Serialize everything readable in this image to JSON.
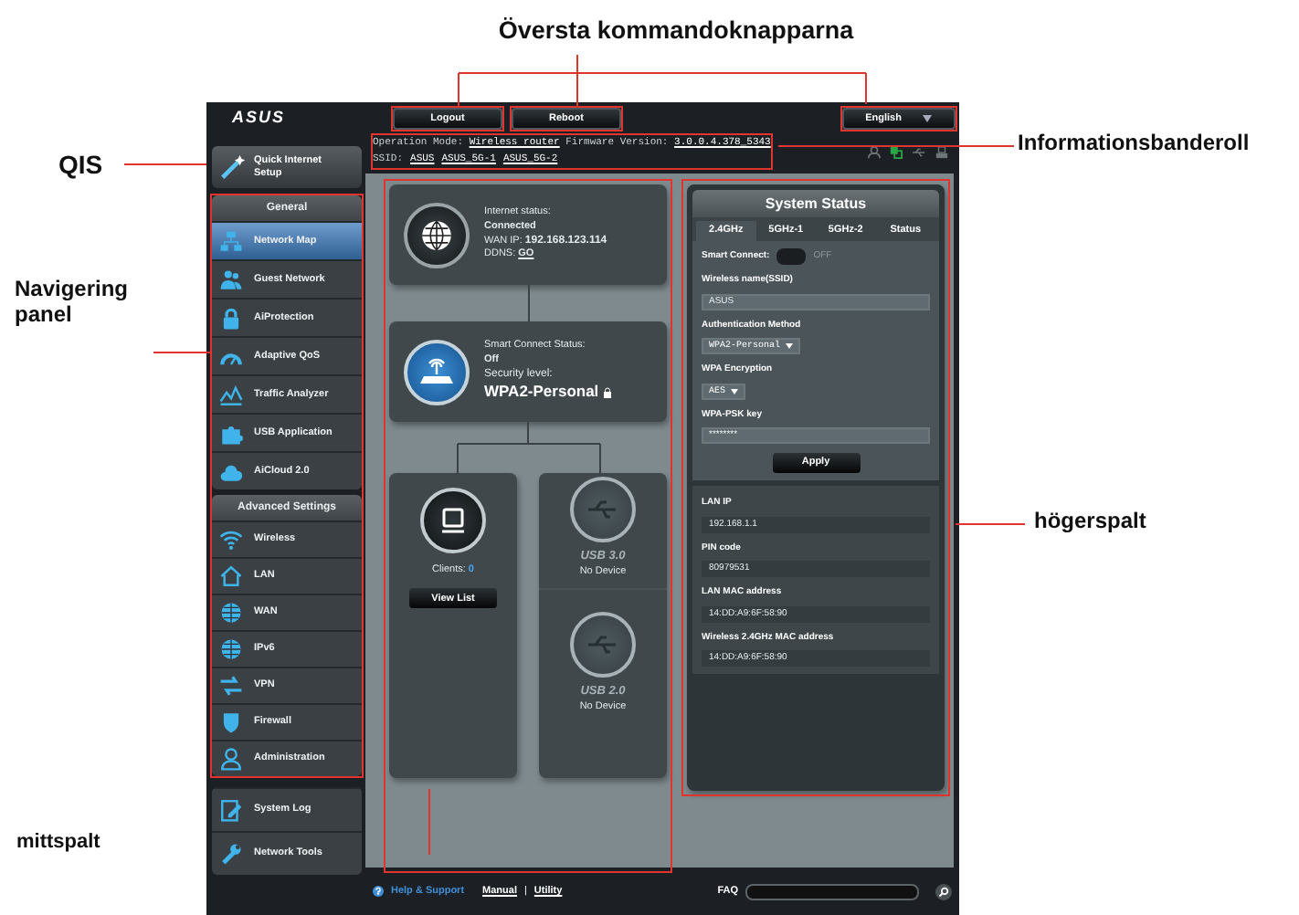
{
  "callouts": {
    "top_buttons": "Översta kommandoknapparna",
    "qis": "QIS",
    "info": "Informationsbanderoll",
    "nav": "Navigering panel",
    "right": "högerspalt",
    "middle": "mittspalt"
  },
  "header": {
    "logo": "ASUS",
    "buttons": [
      "Logout",
      "Reboot"
    ],
    "language": "English"
  },
  "info_banner": {
    "mode_label": "Operation Mode:",
    "mode": "Wireless router",
    "fw_label": "Firmware Version:",
    "fw": "3.0.0.4.378_5343",
    "ssid_label": "SSID:",
    "ssids": [
      "ASUS",
      "ASUS_5G-1",
      "ASUS_5G-2"
    ]
  },
  "nav": {
    "qis": "Quick Internet Setup",
    "general_title": "General",
    "general": [
      {
        "label": "Network Map",
        "kind": "network",
        "selected": true
      },
      {
        "label": "Guest Network",
        "kind": "people",
        "selected": false
      },
      {
        "label": "AiProtection",
        "kind": "lock",
        "selected": false
      },
      {
        "label": "Adaptive QoS",
        "kind": "gauge",
        "selected": false
      },
      {
        "label": "Traffic Analyzer",
        "kind": "chart",
        "selected": false
      },
      {
        "label": "USB Application",
        "kind": "puzzle",
        "selected": false
      },
      {
        "label": "AiCloud 2.0",
        "kind": "cloud",
        "selected": false
      }
    ],
    "advanced_title": "Advanced Settings",
    "advanced": [
      {
        "label": "Wireless",
        "kind": "wifi",
        "selected": false
      },
      {
        "label": "LAN",
        "kind": "house",
        "selected": false
      },
      {
        "label": "WAN",
        "kind": "globe",
        "selected": false
      },
      {
        "label": "IPv6",
        "kind": "globe",
        "selected": false
      },
      {
        "label": "VPN",
        "kind": "arrows",
        "selected": false
      },
      {
        "label": "Firewall",
        "kind": "shield",
        "selected": false
      },
      {
        "label": "Administration",
        "kind": "person",
        "selected": false
      }
    ],
    "tools": [
      {
        "label": "System Log",
        "kind": "document",
        "selected": false
      },
      {
        "label": "Network Tools",
        "kind": "wrench",
        "selected": false
      }
    ]
  },
  "internet": {
    "status_label": "Internet status:",
    "status": "Connected",
    "wan_label": "WAN IP:",
    "wan": "192.168.123.114",
    "ddns_label": "DDNS:",
    "ddns": "GO"
  },
  "router": {
    "smart_label": "Smart Connect Status:",
    "smart": "Off",
    "security_label": "Security level:",
    "security": "WPA2-Personal"
  },
  "clients": {
    "label": "Clients:",
    "count": "0",
    "button": "View List"
  },
  "usb": [
    {
      "name": "USB 3.0",
      "status": "No Device"
    },
    {
      "name": "USB 2.0",
      "status": "No Device"
    }
  ],
  "system_status": {
    "title": "System Status",
    "tabs": [
      {
        "label": "2.4GHz",
        "selected": true
      },
      {
        "label": "5GHz-1",
        "selected": false
      },
      {
        "label": "5GHz-2",
        "selected": false
      },
      {
        "label": "Status",
        "selected": false
      }
    ],
    "smart_connect": {
      "label": "Smart Connect:",
      "on": false,
      "text": "OFF"
    },
    "fields": [
      {
        "label": "Wireless name(SSID)",
        "kind": "text",
        "value": "ASUS"
      },
      {
        "label": "Authentication Method",
        "kind": "select",
        "value": "WPA2-Personal"
      },
      {
        "label": "WPA Encryption",
        "kind": "select",
        "value": "AES"
      },
      {
        "label": "WPA-PSK key",
        "kind": "text",
        "value": "********"
      }
    ],
    "apply": "Apply",
    "info": [
      {
        "label": "LAN IP",
        "value": "192.168.1.1"
      },
      {
        "label": "PIN code",
        "value": "80979531"
      },
      {
        "label": "LAN MAC address",
        "value": "14:DD:A9:6F:58:90"
      },
      {
        "label": "Wireless 2.4GHz MAC address",
        "value": "14:DD:A9:6F:58:90"
      }
    ]
  },
  "footer": {
    "help": "Help & Support",
    "manual": "Manual",
    "separator": "|",
    "utility": "Utility",
    "faq": "FAQ"
  }
}
